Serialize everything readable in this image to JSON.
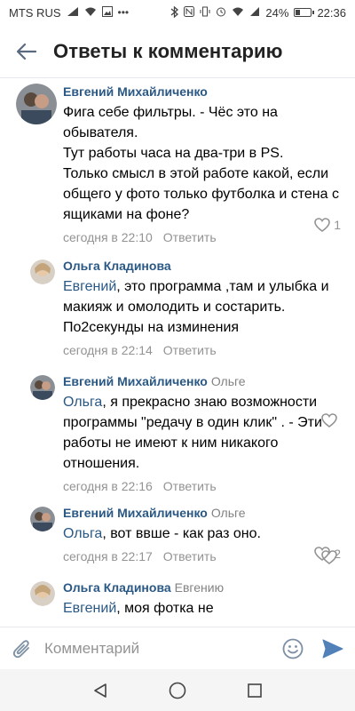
{
  "status": {
    "carrier": "MTS RUS",
    "battery": "24%",
    "battery_level": 0.24,
    "time": "22:36"
  },
  "header": {
    "title": "Ответы к комментарию"
  },
  "comments": [
    {
      "author": "Евгений Михайличенко",
      "reply_to": "",
      "mention": "",
      "text": "Фига себе фильтры. - Чёс это на обывателя.\nТут работы часа на два-три в PS.\nТолько смысл в этой работе какой, если общего у фото только футболка и стена с ящиками на фоне?",
      "time": "сегодня в 22:10",
      "reply_label": "Ответить",
      "likes": "1"
    },
    {
      "author": "Ольга Кладинова",
      "reply_to": "",
      "mention": "Евгений",
      "text": ", это программа ,там и улыбка и макияж и омолодить и состарить. По2секунды на изминения",
      "time": "сегодня в 22:14",
      "reply_label": "Ответить",
      "likes": ""
    },
    {
      "author": "Евгений Михайличенко",
      "reply_to": "Ольге",
      "mention": "Ольга",
      "text": ", я прекрасно знаю возможности программы \"редачу в один клик\" .  - Эти работы не имеют к ним никакого отношения.",
      "time": "сегодня в 22:16",
      "reply_label": "Ответить",
      "likes": "2"
    },
    {
      "author": "Евгений Михайличенко",
      "reply_to": "Ольге",
      "mention": "Ольга",
      "text": ", вот ввше - как раз оно.",
      "time": "сегодня в 22:17",
      "reply_label": "Ответить",
      "likes": ""
    },
    {
      "author": "Ольга Кладинова",
      "reply_to": "Евгению",
      "mention": "Евгений",
      "text": ", моя фотка не",
      "time": "",
      "reply_label": "",
      "likes": ""
    }
  ],
  "composer": {
    "placeholder": "Комментарий"
  },
  "colors": {
    "link": "#2a5885",
    "meta": "#939393",
    "accent": "#5181b8"
  }
}
